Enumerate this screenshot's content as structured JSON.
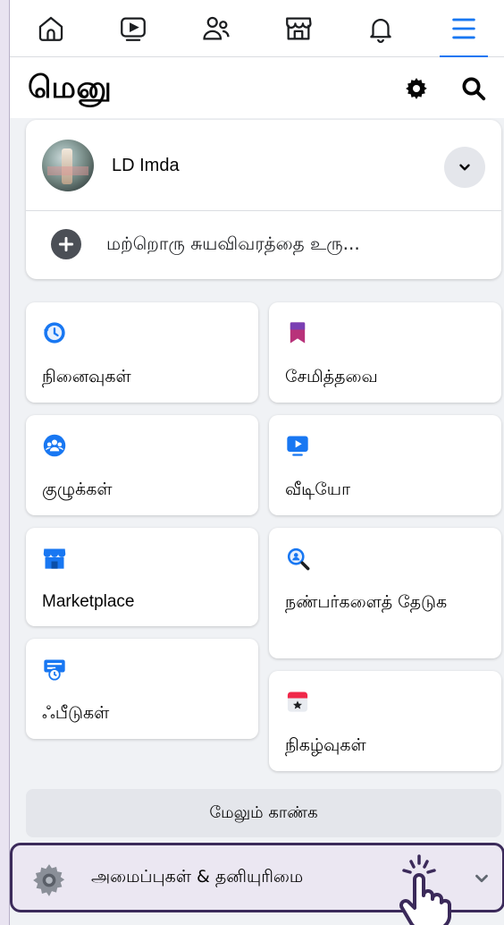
{
  "nav": {
    "tabs": [
      {
        "icon": "home-icon",
        "active": false
      },
      {
        "icon": "video-icon",
        "active": false
      },
      {
        "icon": "friends-icon",
        "active": false
      },
      {
        "icon": "marketplace-icon",
        "active": false
      },
      {
        "icon": "bell-icon",
        "active": false
      },
      {
        "icon": "menu-icon",
        "active": true
      }
    ]
  },
  "header": {
    "title": "மெனு",
    "settings_icon": "gear-icon",
    "search_icon": "search-icon"
  },
  "profile": {
    "name": "LD Imda",
    "create_profile": "மற்றொரு சுயவிவரத்தை உரு..."
  },
  "shortcuts": [
    {
      "label": "நினைவுகள்",
      "icon": "memories-icon"
    },
    {
      "label": "சேமித்தவை",
      "icon": "bookmark-icon"
    },
    {
      "label": "குழுக்கள்",
      "icon": "groups-icon"
    },
    {
      "label": "வீடியோ",
      "icon": "video-tile-icon"
    },
    {
      "label": "Marketplace",
      "icon": "marketplace-tile-icon"
    },
    {
      "label": "நண்பர்களைத் தேடுக",
      "icon": "find-friends-icon"
    },
    {
      "label": "ஃபீடுகள்",
      "icon": "feeds-icon"
    },
    {
      "label": "நிகழ்வுகள்",
      "icon": "events-icon"
    }
  ],
  "see_more": "மேலும் காண்க",
  "settings": {
    "label": "அமைப்புகள் & தனியுரிமை"
  },
  "colors": {
    "accent": "#1877f2",
    "highlight_border": "#3b2a5a"
  }
}
